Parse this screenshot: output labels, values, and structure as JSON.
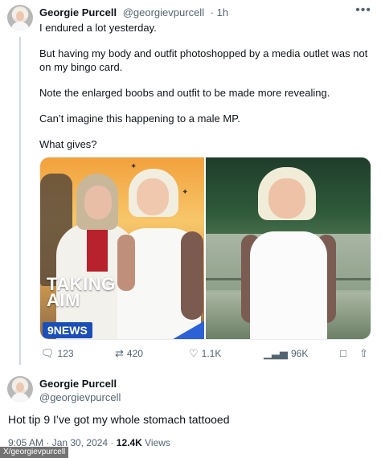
{
  "tweet": {
    "author_name": "Georgie Purcell",
    "author_handle": "@georgievpurcell",
    "time_ago": "· 1h",
    "more_icon": "more-horizontal-icon",
    "paragraphs": [
      "I endured a lot yesterday.",
      "But having my body and outfit photoshopped by a media outlet was not on my bingo card.",
      "Note the enlarged boobs and outfit to be made more revealing.",
      "Can’t imagine this happening to a male MP.",
      "What gives?"
    ],
    "media": {
      "overlay_title_line1": "TAKING",
      "overlay_title_line2": "AIM",
      "news_badge": "9NEWS"
    },
    "actions": {
      "replies": "123",
      "retweets": "420",
      "likes": "1.1K",
      "views": "96K"
    }
  },
  "reply": {
    "author_name": "Georgie Purcell",
    "author_handle": "@georgievpurcell",
    "text": "Hot tip 9 I’ve got my whole stomach tattooed",
    "time": "9:05 AM · Jan 30, 2024 ·",
    "views_count": "12.4K",
    "views_label": "Views"
  },
  "watermark": "X/georgievpurcell"
}
